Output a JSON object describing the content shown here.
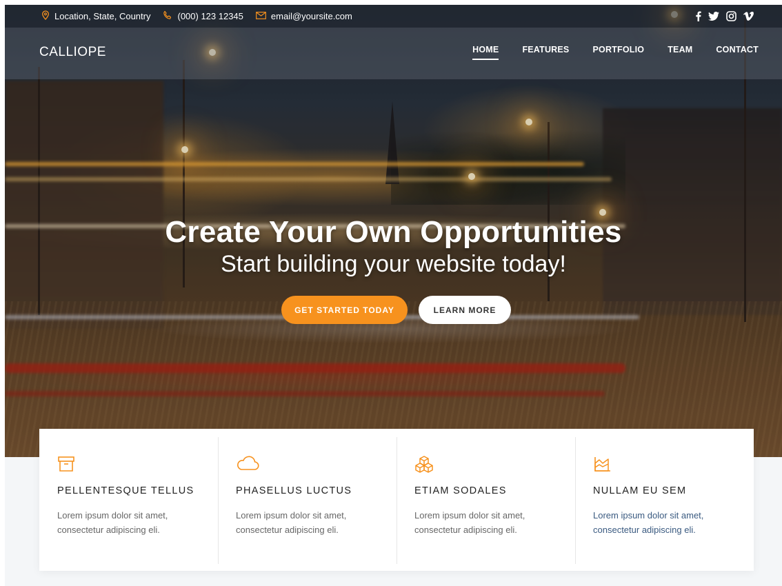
{
  "topbar": {
    "location": "Location, State, Country",
    "phone": "(000) 123 12345",
    "email": "email@yoursite.com",
    "social_icons": [
      "facebook-icon",
      "twitter-icon",
      "instagram-icon",
      "vimeo-icon"
    ]
  },
  "nav": {
    "brand": "CALLIOPE",
    "items": [
      {
        "label": "HOME",
        "active": true
      },
      {
        "label": "FEATURES",
        "active": false
      },
      {
        "label": "PORTFOLIO",
        "active": false
      },
      {
        "label": "TEAM",
        "active": false
      },
      {
        "label": "CONTACT",
        "active": false
      }
    ]
  },
  "hero": {
    "headline": "Create Your Own Opportunities",
    "subheadline": "Start building your website today!",
    "primary_button": "GET STARTED TODAY",
    "secondary_button": "LEARN MORE"
  },
  "features": [
    {
      "icon": "archive-box-icon",
      "title": "PELLENTESQUE TELLUS",
      "line1": "Lorem ipsum dolor sit amet,",
      "line2": "consectetur adipiscing eli."
    },
    {
      "icon": "cloud-icon",
      "title": "PHASELLUS LUCTUS",
      "line1": "Lorem ipsum dolor sit amet,",
      "line2": "consectetur adipiscing eli."
    },
    {
      "icon": "cubes-icon",
      "title": "ETIAM SODALES",
      "line1": "Lorem ipsum dolor sit amet,",
      "line2": "consectetur adipiscing eli."
    },
    {
      "icon": "area-chart-icon",
      "title": "NULLAM EU SEM",
      "line1": "Lorem ipsum dolor sit amet,",
      "line2": "consectetur adipiscing eli."
    }
  ],
  "colors": {
    "accent": "#f7921e",
    "text_dark": "#222222",
    "text_body": "#666666"
  }
}
